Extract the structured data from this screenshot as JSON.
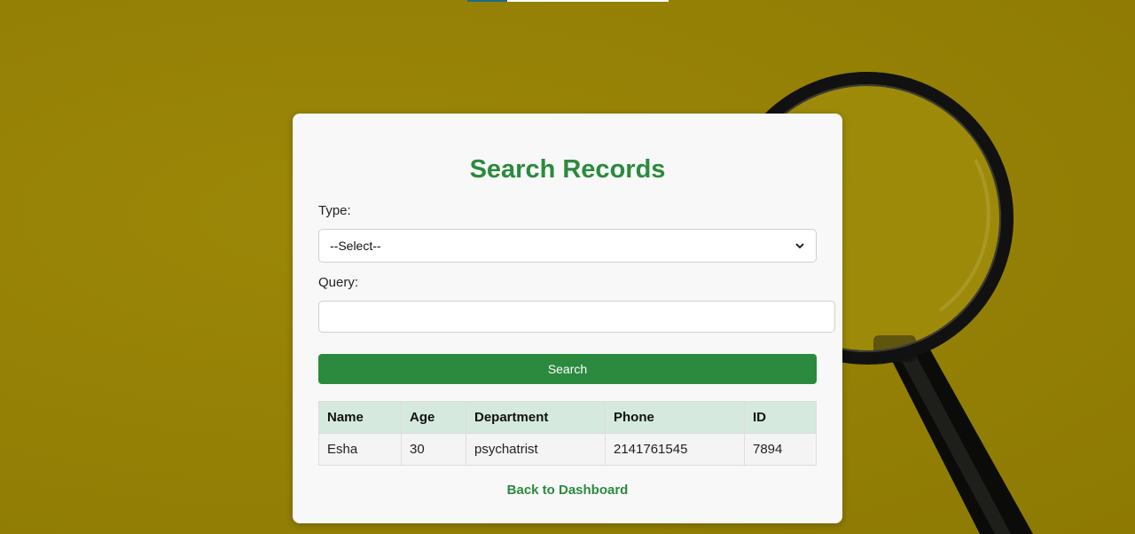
{
  "page": {
    "title": "Search Records",
    "background_color": "#958204",
    "accent_color": "#2b8a3e"
  },
  "form": {
    "type_label": "Type:",
    "type_selected": "--Select--",
    "query_label": "Query:",
    "query_value": "",
    "search_button": "Search"
  },
  "table": {
    "headers": [
      "Name",
      "Age",
      "Department",
      "Phone",
      "ID"
    ],
    "rows": [
      [
        "Esha",
        "30",
        "psychatrist",
        "2141761545",
        "7894"
      ]
    ]
  },
  "links": {
    "back": "Back to Dashboard"
  },
  "icons": {
    "select_arrow": "chevron-down-icon",
    "background_image": "magnifying-glass-icon"
  }
}
